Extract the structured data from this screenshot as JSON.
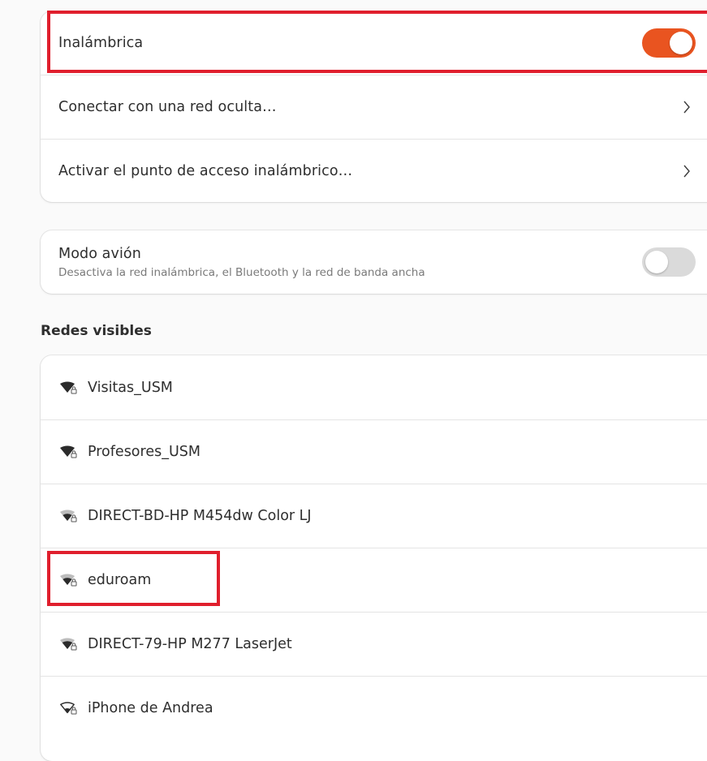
{
  "wireless_card": {
    "wireless_label": "Inalámbrica",
    "wireless_enabled": true,
    "hidden_network_label": "Conectar con una red oculta…",
    "hotspot_label": "Activar el punto de acceso inalámbrico…"
  },
  "airplane": {
    "title": "Modo avión",
    "subtitle": "Desactiva la red inalámbrica, el Bluetooth y la red de banda ancha",
    "enabled": false
  },
  "networks_section": {
    "title": "Redes visibles",
    "networks": [
      {
        "name": "Visitas_USM",
        "signal": "full",
        "secured": true
      },
      {
        "name": "Profesores_USM",
        "signal": "full",
        "secured": true
      },
      {
        "name": "DIRECT-BD-HP M454dw Color LJ",
        "signal": "good",
        "secured": true
      },
      {
        "name": "eduroam",
        "signal": "good",
        "secured": true
      },
      {
        "name": "DIRECT-79-HP M277 LaserJet",
        "signal": "good",
        "secured": true
      },
      {
        "name": "iPhone de Andrea",
        "signal": "weak",
        "secured": true
      }
    ]
  },
  "colors": {
    "accent": "#e95420",
    "highlight": "#e01f2d"
  },
  "icons": [
    "chevron-right-icon",
    "wifi-signal-icon",
    "lock-icon"
  ]
}
